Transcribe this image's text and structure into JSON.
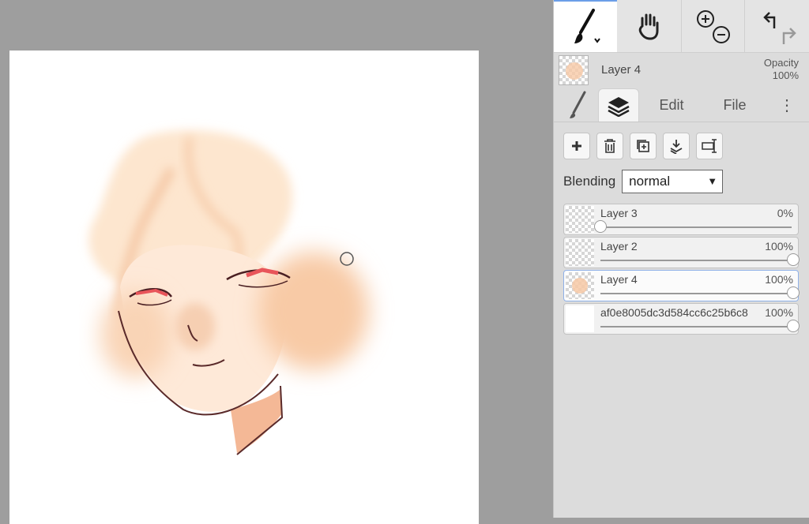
{
  "toolbar": {
    "tools": [
      {
        "icon": "brush-icon",
        "active": true
      },
      {
        "icon": "hand-icon",
        "active": false
      },
      {
        "icon": "zoom-icon",
        "active": false
      },
      {
        "icon": "undo-redo-icon",
        "active": false
      }
    ]
  },
  "current_layer": {
    "name": "Layer 4",
    "opacity_label": "Opacity",
    "opacity_value": "100%"
  },
  "tabs": {
    "brush": "brush-tab-icon",
    "layers": "layers-tab-icon",
    "edit": "Edit",
    "file": "File",
    "more": "⋮"
  },
  "layer_actions": [
    "add-layer-icon",
    "delete-layer-icon",
    "duplicate-layer-icon",
    "merge-down-icon",
    "rename-layer-icon"
  ],
  "blending": {
    "label": "Blending",
    "value": "normal"
  },
  "layers": [
    {
      "name": "Layer 3",
      "opacity": "0%",
      "opacity_value": 0,
      "active": false
    },
    {
      "name": "Layer 2",
      "opacity": "100%",
      "opacity_value": 1,
      "active": false
    },
    {
      "name": "Layer 4",
      "opacity": "100%",
      "opacity_value": 1,
      "active": true
    },
    {
      "name": "af0e8005dc3d584cc6c25b6c8",
      "opacity": "100%",
      "opacity_value": 1,
      "active": false
    }
  ],
  "colors": {
    "accent": "#6b9ee8",
    "skin": "#fde3cc",
    "blush": "#f6b894",
    "line": "#5a2a2a",
    "eye_red": "#e8555a"
  }
}
